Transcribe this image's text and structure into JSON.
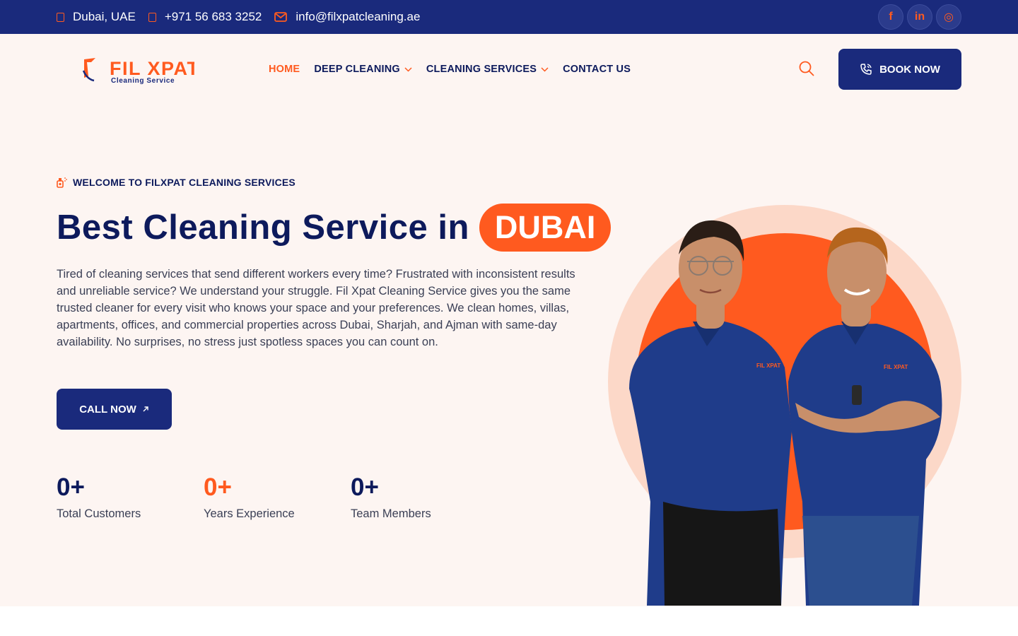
{
  "topbar": {
    "location": "Dubai, UAE",
    "phone": "+971 56 683 3252",
    "email": "info@filxpatcleaning.ae",
    "socials": [
      {
        "name": "facebook",
        "glyph": "f"
      },
      {
        "name": "linkedin",
        "glyph": "in"
      },
      {
        "name": "instagram",
        "glyph": "◎"
      }
    ]
  },
  "logo": {
    "main": "FIL XPAT",
    "sub": "Cleaning Service"
  },
  "nav": {
    "items": [
      {
        "label": "HOME"
      },
      {
        "label": "DEEP CLEANING"
      },
      {
        "label": "CLEANING SERVICES"
      },
      {
        "label": "CONTACT US"
      }
    ]
  },
  "header": {
    "book_label": "BOOK NOW",
    "search_icon": "search-icon"
  },
  "hero": {
    "welcome": "WELCOME TO FILXPAT CLEANING SERVICES",
    "headline": "Best Cleaning Service in",
    "highlight": "DUBAI",
    "description": "Tired of cleaning services that send different workers every time? Frustrated with inconsistent results and unreliable service? We understand your struggle. Fil Xpat Cleaning Service gives you the same trusted cleaner for every visit who knows your space and your preferences. We clean homes, villas, apartments, offices, and commercial properties across Dubai, Sharjah, and Ajman with same-day availability. No surprises, no stress just spotless spaces you can count on.",
    "cta": "CALL NOW",
    "stats": [
      {
        "value": "0+",
        "label": "Total Customers"
      },
      {
        "value": "0+",
        "label": "Years Experience"
      },
      {
        "value": "0+",
        "label": "Team Members"
      }
    ],
    "image_badge": "FIL XPAT"
  },
  "colors": {
    "navy": "#1a2a7c",
    "orange": "#ff5a1f",
    "cream": "#fdf5f2",
    "peach": "#fcd8c8"
  }
}
